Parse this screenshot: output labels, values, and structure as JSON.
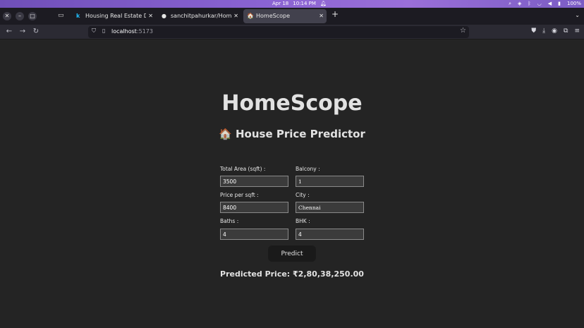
{
  "os": {
    "date": "Apr 18",
    "time": "10:14 PM",
    "battery": "100%"
  },
  "tabs": [
    {
      "label": "Housing Real Estate Data fr",
      "favicon": "k"
    },
    {
      "label": "sanchitpahurkar/HomeScop",
      "favicon": "github-icon"
    },
    {
      "label": "HomeScope",
      "favicon": "house-icon"
    }
  ],
  "url": {
    "host": "localhost",
    "port": ":5173"
  },
  "page": {
    "title": "HomeScope",
    "subtitle": "🏠 House Price Predictor",
    "form": {
      "total_area_label": "Total Area (sqft) :",
      "total_area_value": "3500",
      "balcony_label": "Balcony :",
      "balcony_value": "1",
      "price_per_sqft_label": "Price per sqft :",
      "price_per_sqft_value": "8400",
      "city_label": "City :",
      "city_value": "Chennai",
      "baths_label": "Baths :",
      "baths_value": "4",
      "bhk_label": "BHK :",
      "bhk_value": "4"
    },
    "predict_label": "Predict",
    "result": "Predicted Price: ₹2,80,38,250.00"
  }
}
